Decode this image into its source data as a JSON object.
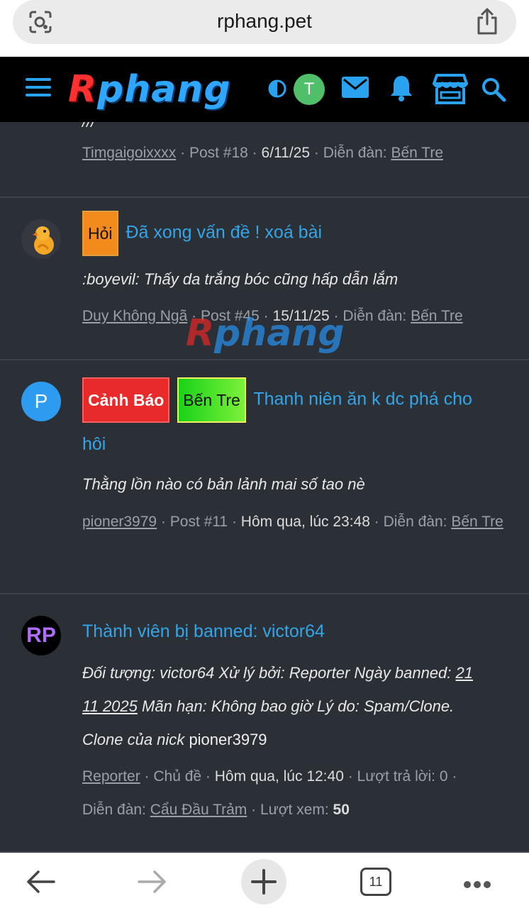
{
  "browser": {
    "url": "rphang.pet",
    "tab_count": "11"
  },
  "site_header": {
    "logo_r": "R",
    "logo_rest": "phang",
    "user_initial": "T"
  },
  "watermark": {
    "r": "R",
    "rest": "phang"
  },
  "posts": [
    {
      "snippet_tail": "///",
      "author": "Timgaigoixxxx",
      "post_no": "Post #18",
      "date": "6/11/25",
      "forum_label": "Diễn đàn:",
      "forum": "Bến Tre"
    },
    {
      "prefix": "Hỏi",
      "title": "Đã xong vấn đề ! xoá bài",
      "snippet": ":boyevil: Thấy da trắng bóc cũng hấp dẫn lắm",
      "author": "Duy Không Ngã",
      "post_no": "Post #45",
      "date": "15/11/25",
      "forum_label": "Diễn đàn:",
      "forum": "Bến Tre"
    },
    {
      "avatar_letter": "P",
      "prefix1": "Cảnh Báo",
      "prefix2": "Bến Tre",
      "title_part1": "Thanh niên ăn k dc phá cho",
      "title_part2": "hôi",
      "snippet": "Thằng lồn nào có bản lảnh mai số tao nè",
      "author": "pioner3979",
      "post_no": "Post #11",
      "date": "Hôm qua, lúc 23:48",
      "forum_label": "Diễn đàn:",
      "forum": "Bến Tre"
    },
    {
      "avatar_text": "RP",
      "title": "Thành viên bị banned: victor64",
      "snippet_line1": "Đối tượng: victor64 Xử lý bởi: Reporter Ngày banned:",
      "snippet_date1": "21",
      "snippet_date2": "11 2025",
      "snippet_line2": "Mãn hạn: Không bao giờ Lý do: Spam/Clone.",
      "snippet_line3": "Clone của nick",
      "snippet_nick": "pioner3979",
      "author": "Reporter",
      "type": "Chủ đề",
      "date": "Hôm qua, lúc 12:40",
      "replies": "Lượt trả lời: 0",
      "forum_label": "Diễn đàn:",
      "forum": "Cẩu Đầu Trảm",
      "views_label": "Lượt xem:",
      "views": "50"
    }
  ]
}
